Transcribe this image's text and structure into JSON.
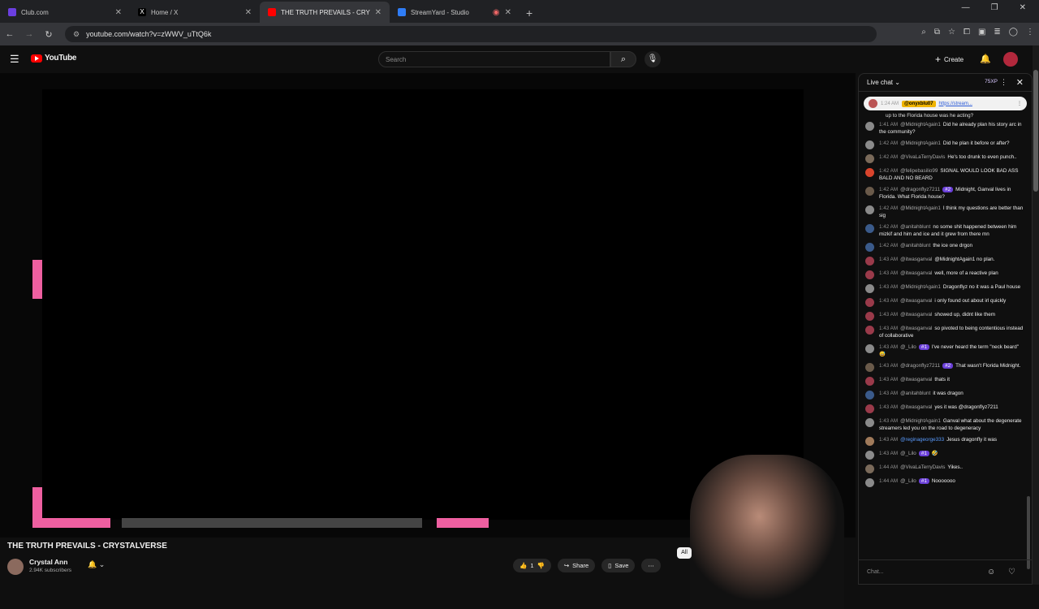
{
  "browser": {
    "tabs": [
      {
        "title": "Club.com",
        "color": "#6b3fe0"
      },
      {
        "title": "Home / X",
        "color": "#000000"
      },
      {
        "title": "THE TRUTH PREVAILS - CRYSTA",
        "color": "#ff0000"
      },
      {
        "title": "StreamYard - Studio",
        "color": "#2f7df6"
      }
    ],
    "url": "youtube.com/watch?v=zWWV_uTtQ6k"
  },
  "youtube": {
    "logo_text": "YouTube",
    "search_placeholder": "Search",
    "create_label": "Create"
  },
  "video": {
    "title": "THE TRUTH PREVAILS - CRYSTALVERSE",
    "channel": "Crystal Ann",
    "subscribers": "2.94K subscribers",
    "likes": "1",
    "share_label": "Share",
    "save_label": "Save",
    "chip_label": "All"
  },
  "chat": {
    "header": "Live chat",
    "xp": "75XP",
    "pinned_user": "@onyxblu07",
    "pinned_link": "https://stream...",
    "pinned_time": "1:24 AM",
    "partial_text": "up to the Florida house was he acting?",
    "input_placeholder": "Chat...",
    "messages": [
      {
        "time": "1:41 AM",
        "user": "@MidnightAgain1",
        "badge": "",
        "text": "Did he already plan his story arc in the community?",
        "avatar": "#8a8a8a"
      },
      {
        "time": "1:42 AM",
        "user": "@MidnightAgain1",
        "badge": "",
        "text": "Did he plan it before or after?",
        "avatar": "#8a8a8a"
      },
      {
        "time": "1:42 AM",
        "user": "@VivaLaTerryDavis",
        "badge": "",
        "text": "He's too drunk to even punch..",
        "avatar": "#7a6a5a"
      },
      {
        "time": "1:42 AM",
        "user": "@felipebasilio99",
        "badge": "",
        "text": "SIGNAL WOULD LOOK BAD ASS BALD AND NO BEARD",
        "avatar": "#d9442c"
      },
      {
        "time": "1:42 AM",
        "user": "@dragonflyz7211",
        "badge": "#2",
        "text": "Midnight, Ganval lives in Florida. What Florida house?",
        "avatar": "#6a5a4a"
      },
      {
        "time": "1:42 AM",
        "user": "@MidnightAgain1",
        "badge": "",
        "text": "I think my questions are better than sig",
        "avatar": "#8a8a8a"
      },
      {
        "time": "1:42 AM",
        "user": "@anitahblunt",
        "badge": "",
        "text": "no some shit happened between him mizkif and him and ice and it grew from there mn",
        "avatar": "#3a5a8a"
      },
      {
        "time": "1:42 AM",
        "user": "@anitahblunt",
        "badge": "",
        "text": "the ice one drgon",
        "avatar": "#3a5a8a"
      },
      {
        "time": "1:43 AM",
        "user": "@itwasganval",
        "badge": "",
        "text": "@MidnightAgain1 no plan.",
        "avatar": "#9a3a4a"
      },
      {
        "time": "1:43 AM",
        "user": "@itwasganval",
        "badge": "",
        "text": "well, more of a reactive plan",
        "avatar": "#9a3a4a"
      },
      {
        "time": "1:43 AM",
        "user": "@MidnightAgain1",
        "badge": "",
        "text": "Dragonflyz no it was a Paul house",
        "avatar": "#8a8a8a"
      },
      {
        "time": "1:43 AM",
        "user": "@itwasganval",
        "badge": "",
        "text": "i only found out about irl quickly",
        "avatar": "#9a3a4a"
      },
      {
        "time": "1:43 AM",
        "user": "@itwasganval",
        "badge": "",
        "text": "showed up, didnt like them",
        "avatar": "#9a3a4a"
      },
      {
        "time": "1:43 AM",
        "user": "@itwasganval",
        "badge": "",
        "text": "so pivoted to being contentious instead of collaborative",
        "avatar": "#9a3a4a"
      },
      {
        "time": "1:43 AM",
        "user": "@_Lilo",
        "badge": "#1",
        "text": "I've never heard the term \"neck beard\" 😅",
        "avatar": "#8a8a8a"
      },
      {
        "time": "1:43 AM",
        "user": "@dragonflyz7211",
        "badge": "#2",
        "text": "That wasn't Florida Midnight.",
        "avatar": "#6a5a4a"
      },
      {
        "time": "1:43 AM",
        "user": "@itwasganval",
        "badge": "",
        "text": "thats it",
        "avatar": "#9a3a4a"
      },
      {
        "time": "1:43 AM",
        "user": "@anitahblunt",
        "badge": "",
        "text": "it was dragon",
        "avatar": "#3a5a8a"
      },
      {
        "time": "1:43 AM",
        "user": "@itwasganval",
        "badge": "",
        "text": "yes it was @dragonflyz7211",
        "avatar": "#9a3a4a"
      },
      {
        "time": "1:43 AM",
        "user": "@MidnightAgain1",
        "badge": "",
        "text": "Ganval what about the degenerate streamers led you on the road to degeneracy",
        "avatar": "#8a8a8a"
      },
      {
        "time": "1:43 AM",
        "user": "@reginageorge333",
        "badge": "",
        "text": "Jesus dragonfly it was",
        "avatar": "#a07a5a",
        "blue": true
      },
      {
        "time": "1:43 AM",
        "user": "@_Lilo",
        "badge": "#1",
        "text": "🤣",
        "avatar": "#8a8a8a"
      },
      {
        "time": "1:44 AM",
        "user": "@VivaLaTerryDavis",
        "badge": "",
        "text": "Yikes..",
        "avatar": "#7a6a5a"
      },
      {
        "time": "1:44 AM",
        "user": "@_Lilo",
        "badge": "#1",
        "text": "Nooooooo",
        "avatar": "#8a8a8a"
      }
    ]
  }
}
